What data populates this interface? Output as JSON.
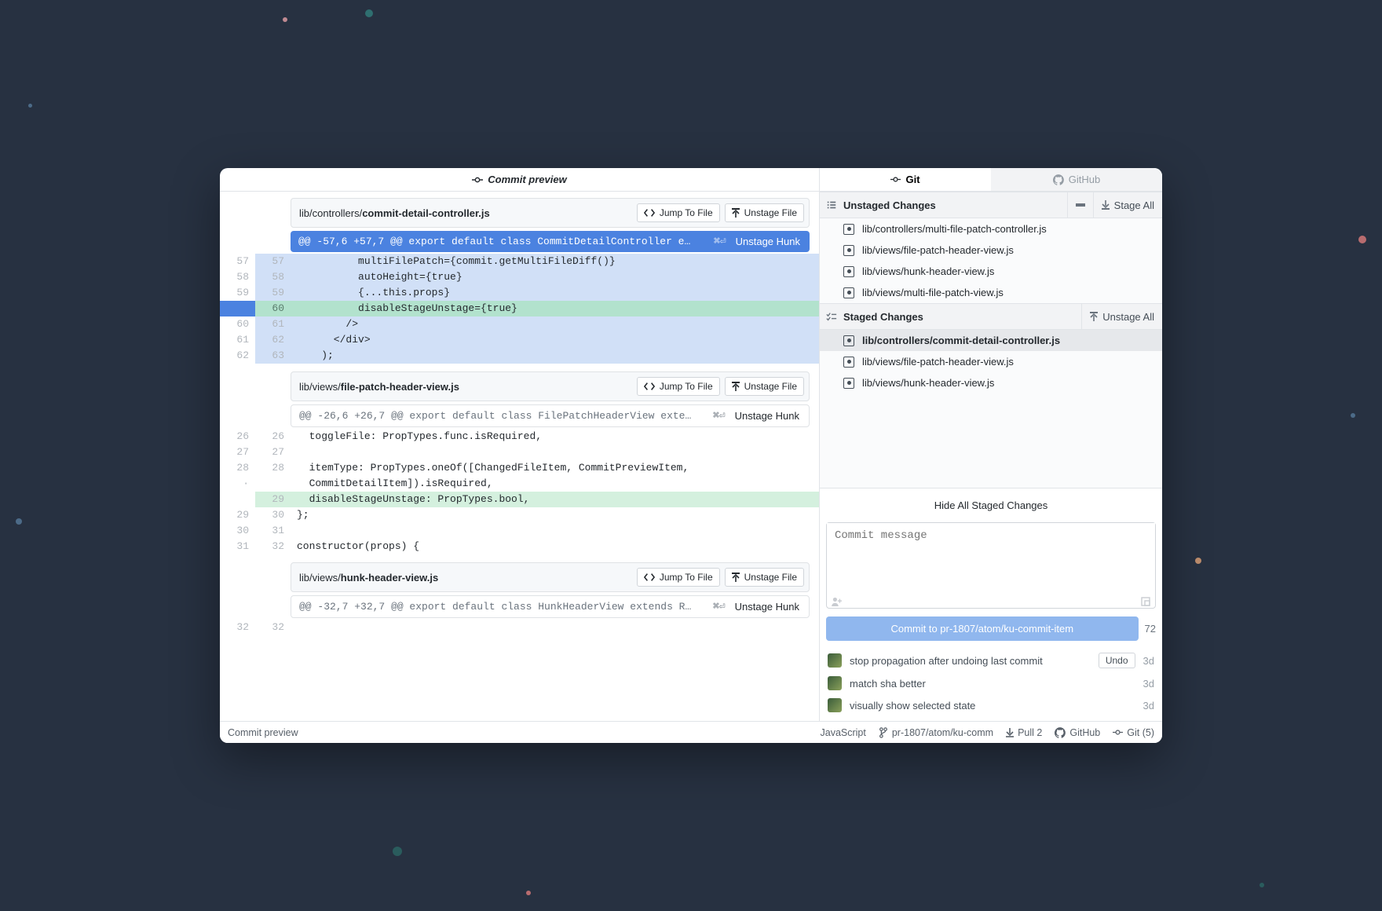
{
  "left": {
    "title": "Commit preview",
    "files": [
      {
        "pathPrefix": "lib/controllers/",
        "pathBold": "commit-detail-controller.js",
        "jumpLabel": "Jump To File",
        "unstageFileLabel": "Unstage File",
        "hunks": [
          {
            "active": true,
            "header": "@@ -57,6 +57,7 @@ export default class CommitDetailController e…",
            "kbd": "⌘⏎",
            "unstageHunkLabel": "Unstage Hunk",
            "lines": [
              {
                "a": "57",
                "b": "57",
                "cls": "hl",
                "t": "          multiFilePatch={commit.getMultiFileDiff()}"
              },
              {
                "a": "58",
                "b": "58",
                "cls": "hl",
                "t": "          autoHeight={true}"
              },
              {
                "a": "59",
                "b": "59",
                "cls": "hl",
                "t": "          {...this.props}"
              },
              {
                "a": "",
                "b": "60",
                "cls": "hl-focus",
                "t": "          disableStageUnstage={true}"
              },
              {
                "a": "60",
                "b": "61",
                "cls": "hl",
                "t": "        />"
              },
              {
                "a": "61",
                "b": "62",
                "cls": "hl",
                "t": "      </div>"
              },
              {
                "a": "62",
                "b": "63",
                "cls": "hl",
                "t": "    );"
              }
            ]
          }
        ]
      },
      {
        "pathPrefix": "lib/views/",
        "pathBold": "file-patch-header-view.js",
        "jumpLabel": "Jump To File",
        "unstageFileLabel": "Unstage File",
        "hunks": [
          {
            "active": false,
            "header": "@@ -26,6 +26,7 @@ export default class FilePatchHeaderView exte…",
            "kbd": "⌘⏎",
            "unstageHunkLabel": "Unstage Hunk",
            "lines": [
              {
                "a": "26",
                "b": "26",
                "cls": "ctx",
                "t": "  toggleFile: PropTypes.func.isRequired,"
              },
              {
                "a": "27",
                "b": "27",
                "cls": "ctx",
                "t": ""
              },
              {
                "a": "28",
                "b": "28",
                "cls": "ctx",
                "t": "  itemType: PropTypes.oneOf([ChangedFileItem, CommitPreviewItem,"
              },
              {
                "a": "·",
                "b": "",
                "cls": "ctx",
                "t": "  CommitDetailItem]).isRequired,",
                "dot": true
              },
              {
                "a": "",
                "b": "29",
                "cls": "add",
                "t": "  disableStageUnstage: PropTypes.bool,"
              },
              {
                "a": "29",
                "b": "30",
                "cls": "ctx",
                "t": "};"
              },
              {
                "a": "30",
                "b": "31",
                "cls": "ctx",
                "t": ""
              },
              {
                "a": "31",
                "b": "32",
                "cls": "ctx",
                "t": "constructor(props) {"
              }
            ]
          }
        ]
      },
      {
        "pathPrefix": "lib/views/",
        "pathBold": "hunk-header-view.js",
        "jumpLabel": "Jump To File",
        "unstageFileLabel": "Unstage File",
        "hunks": [
          {
            "active": false,
            "header": "@@ -32,7 +32,7 @@ export default class HunkHeaderView extends R…",
            "kbd": "⌘⏎",
            "unstageHunkLabel": "Unstage Hunk",
            "lines": [
              {
                "a": "32",
                "b": "32",
                "cls": "ctx",
                "t": ""
              }
            ]
          }
        ]
      }
    ]
  },
  "right": {
    "tabs": {
      "git": "Git",
      "github": "GitHub"
    },
    "unstaged": {
      "title": "Unstaged Changes",
      "stageAll": "Stage All",
      "items": [
        "lib/controllers/multi-file-patch-controller.js",
        "lib/views/file-patch-header-view.js",
        "lib/views/hunk-header-view.js",
        "lib/views/multi-file-patch-view.js"
      ]
    },
    "staged": {
      "title": "Staged Changes",
      "unstageAll": "Unstage All",
      "items": [
        "lib/controllers/commit-detail-controller.js",
        "lib/views/file-patch-header-view.js",
        "lib/views/hunk-header-view.js"
      ],
      "selectedIndex": 0
    },
    "hideStaged": "Hide All Staged Changes",
    "commitPlaceholder": "Commit message",
    "commitButton": "Commit to pr-1807/atom/ku-commit-item",
    "commitCount": "72",
    "recent": [
      {
        "msg": "stop propagation after undoing last commit",
        "age": "3d",
        "undo": true,
        "undoLabel": "Undo"
      },
      {
        "msg": "match sha better",
        "age": "3d"
      },
      {
        "msg": "visually show selected state",
        "age": "3d"
      }
    ]
  },
  "statusbar": {
    "left": "Commit preview",
    "lang": "JavaScript",
    "branch": "pr-1807/atom/ku-comm",
    "pull": "Pull 2",
    "github": "GitHub",
    "git": "Git (5)"
  }
}
